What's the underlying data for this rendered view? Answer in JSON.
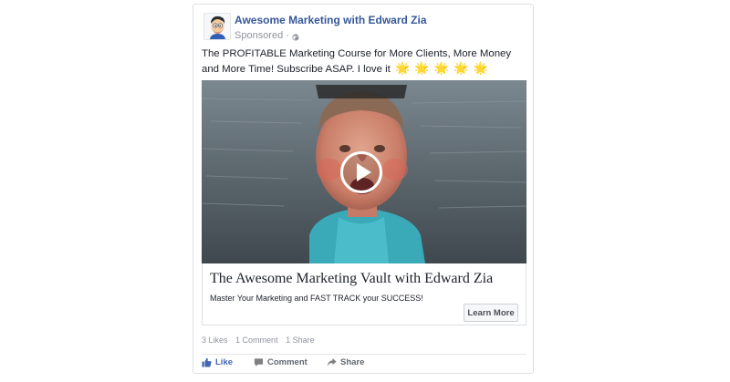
{
  "post": {
    "page_name": "Awesome Marketing with Edward Zia",
    "sponsored": "Sponsored",
    "separator": "·",
    "text": "The PROFITABLE Marketing Course for More Clients, More Money and More Time! Subscribe ASAP. I love it",
    "emojis": [
      "🌟",
      "🌟",
      "🌟",
      "🌟",
      "🌟"
    ]
  },
  "link": {
    "title": "The Awesome Marketing Vault with Edward Zia",
    "description": "Master Your Marketing and FAST TRACK your SUCCESS!",
    "cta_label": "Learn More"
  },
  "stats": {
    "likes": "3 Likes",
    "comments": "1 Comment",
    "shares": "1 Share"
  },
  "actions": {
    "like": "Like",
    "comment": "Comment",
    "share": "Share"
  },
  "icons": {
    "avatar": "cartoon-avatar-icon",
    "privacy": "globe-icon",
    "video_control": "play-icon",
    "like": "thumbs-up-icon",
    "comment": "comment-bubble-icon",
    "share": "share-arrow-icon"
  },
  "colors": {
    "page_name": "#365899",
    "secondary_text": "#90949c",
    "like_active": "#4267b2",
    "action_text": "#606770",
    "card_border": "#dddfe2"
  }
}
